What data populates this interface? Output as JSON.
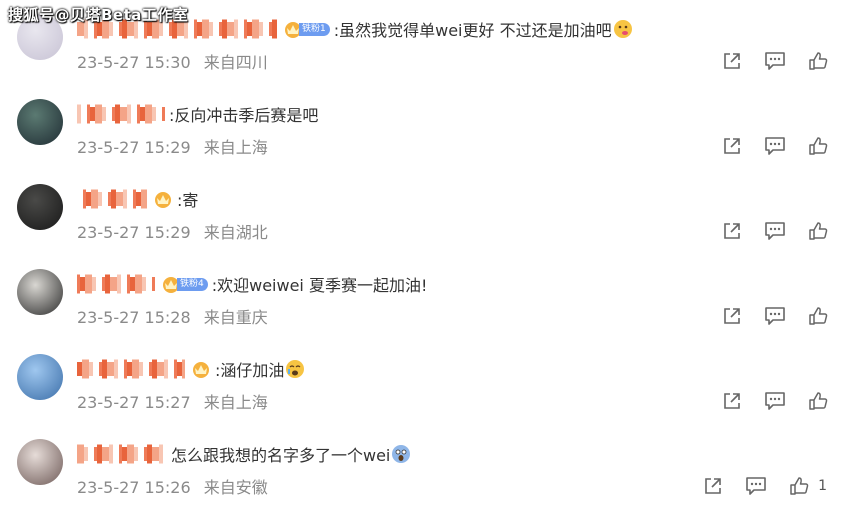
{
  "watermark": "搜狐号@贝塔Beta工作室",
  "colors": {
    "name_mosaic": "#ef7b58",
    "meta_text": "#8a8a8a",
    "fan_badge": "#6d9cf0",
    "icon": "#666666"
  },
  "comments": [
    {
      "name_width": 200,
      "fan_badge": "铁粉1",
      "text": ":虽然我觉得单wei更好 不过还是加油吧",
      "emoji": "drool-face",
      "date": "23-5-27 15:30",
      "location": "来自四川",
      "avatar_colors": [
        "#e9e7ef",
        "#c7c2d4"
      ],
      "likes": ""
    },
    {
      "name_width": 88,
      "fan_badge": "",
      "text": ":反向冲击季后赛是吧",
      "emoji": "",
      "date": "23-5-27 15:29",
      "location": "来自上海",
      "avatar_colors": [
        "#5b7a72",
        "#1f2c33"
      ],
      "likes": ""
    },
    {
      "name_width": 70,
      "fan_badge": "",
      "text": ":寄",
      "emoji": "",
      "date": "23-5-27 15:29",
      "location": "来自湖北",
      "avatar_colors": [
        "#4a4a48",
        "#181818"
      ],
      "likes": ""
    },
    {
      "name_width": 78,
      "fan_badge": "铁粉4",
      "text": ":欢迎weiwei  夏季赛一起加油!",
      "emoji": "",
      "date": "23-5-27 15:28",
      "location": "来自重庆",
      "avatar_colors": [
        "#d9d7d2",
        "#2b2b2b"
      ],
      "likes": ""
    },
    {
      "name_width": 108,
      "fan_badge": "",
      "text": ":涵仔加油",
      "emoji": "cry-face",
      "date": "23-5-27 15:27",
      "location": "来自上海",
      "avatar_colors": [
        "#9fc7ef",
        "#3b6ea8"
      ],
      "likes": ""
    },
    {
      "name_width": 90,
      "fan_badge": "",
      "text": "怎么跟我想的名字多了一个wei",
      "emoji": "shock-face",
      "date": "23-5-27 15:26",
      "location": "来自安徽",
      "avatar_colors": [
        "#e6dcd8",
        "#6e5a57"
      ],
      "likes": "1"
    }
  ]
}
